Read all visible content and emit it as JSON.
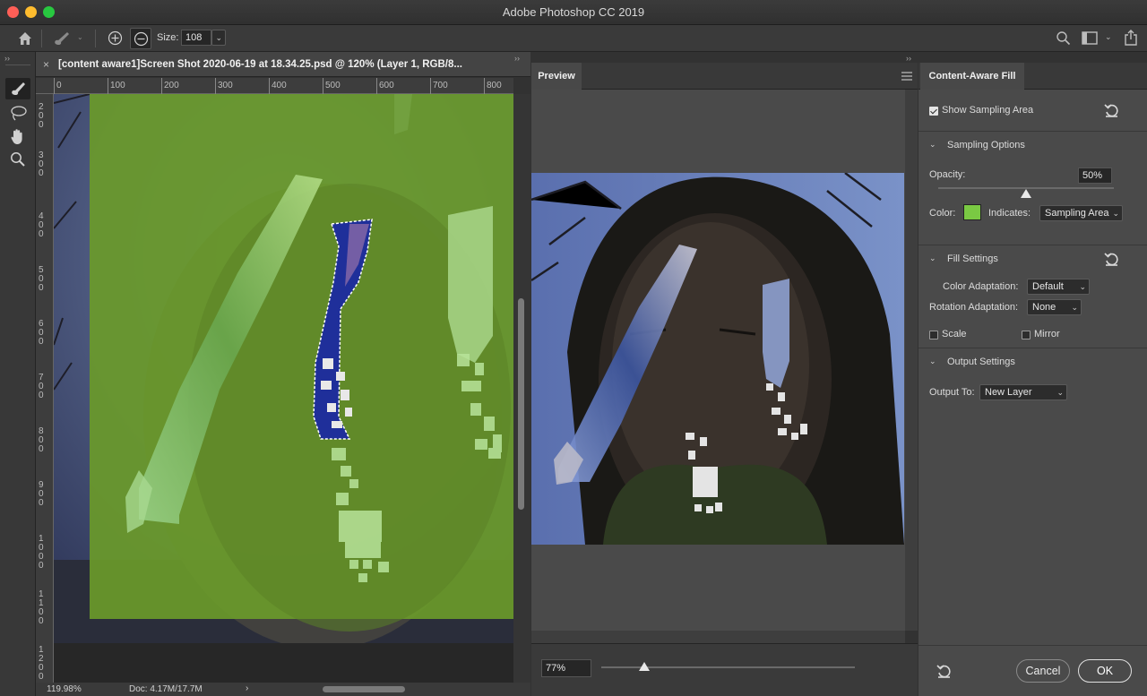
{
  "window": {
    "title": "Adobe Photoshop CC 2019"
  },
  "options_bar": {
    "size_label": "Size:",
    "size_value": "108"
  },
  "document": {
    "tab_title": "[content aware1]Screen Shot 2020-06-19 at 18.34.25.psd @ 120% (Layer 1, RGB/8...",
    "h_ruler": [
      "0",
      "100",
      "200",
      "300",
      "400",
      "500",
      "600",
      "700",
      "800"
    ],
    "v_ruler": [
      [
        "3",
        "0",
        "0"
      ],
      [
        "4",
        "0",
        "0"
      ],
      [
        "5",
        "0",
        "0"
      ],
      [
        "6",
        "0",
        "0"
      ],
      [
        "7",
        "0",
        "0"
      ],
      [
        "8",
        "0",
        "0"
      ],
      [
        "9",
        "0",
        "0"
      ],
      [
        "1",
        "0",
        "0",
        "0"
      ],
      [
        "1",
        "1",
        "0",
        "0"
      ],
      [
        "1",
        "2",
        "0",
        "0"
      ]
    ],
    "v_ruler_top": [
      "2",
      "0",
      "0"
    ],
    "zoom": "119.98%",
    "doc_size": "Doc: 4.17M/17.7M",
    "status_arrow": "›"
  },
  "preview": {
    "tab_label": "Preview",
    "zoom_value": "77%",
    "zoom_slider_fraction": 0.17
  },
  "content_aware_fill": {
    "tab_label": "Content-Aware Fill",
    "show_sampling_area": {
      "label": "Show Sampling Area",
      "checked": true
    },
    "sampling_options": {
      "title": "Sampling Options",
      "opacity_label": "Opacity:",
      "opacity_value": "50%",
      "opacity_fraction": 0.5,
      "color_label": "Color:",
      "color_value": "#7ac943",
      "indicates_label": "Indicates:",
      "indicates_value": "Sampling Area"
    },
    "fill_settings": {
      "title": "Fill Settings",
      "color_adaptation_label": "Color Adaptation:",
      "color_adaptation_value": "Default",
      "rotation_adaptation_label": "Rotation Adaptation:",
      "rotation_adaptation_value": "None",
      "scale_label": "Scale",
      "scale_checked": false,
      "mirror_label": "Mirror",
      "mirror_checked": false
    },
    "output_settings": {
      "title": "Output Settings",
      "output_to_label": "Output To:",
      "output_to_value": "New Layer"
    },
    "cancel_label": "Cancel",
    "ok_label": "OK"
  },
  "colors": {
    "sampling_overlay": "#6a9a2a",
    "accent_green": "#7ac943"
  }
}
